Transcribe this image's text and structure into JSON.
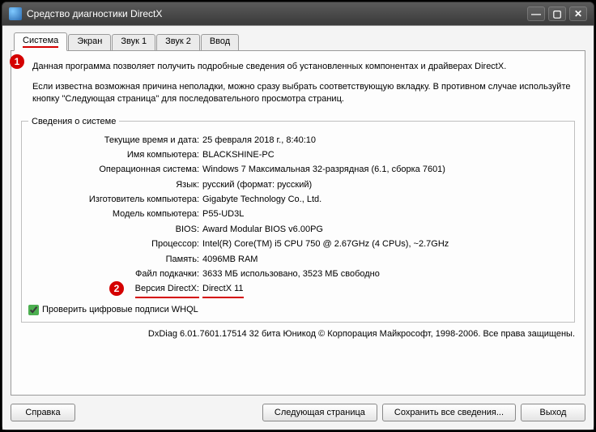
{
  "window": {
    "title": "Средство диагностики DirectX"
  },
  "tabs": [
    "Система",
    "Экран",
    "Звук 1",
    "Звук 2",
    "Ввод"
  ],
  "intro": {
    "p1": "Данная программа позволяет получить подробные сведения об установленных компонентах и драйверах DirectX.",
    "p2": "Если известна возможная причина неполадки, можно сразу выбрать соответствующую вкладку. В противном случае используйте кнопку \"Следующая страница\" для последовательного просмотра страниц."
  },
  "sysinfo": {
    "legend": "Сведения о системе",
    "rows": [
      {
        "label": "Текущие время и дата:",
        "value": "25 февраля 2018 г., 8:40:10"
      },
      {
        "label": "Имя компьютера:",
        "value": "BLACKSHINE-PC"
      },
      {
        "label": "Операционная система:",
        "value": "Windows 7 Максимальная 32-разрядная (6.1, сборка 7601)"
      },
      {
        "label": "Язык:",
        "value": "русский (формат: русский)"
      },
      {
        "label": "Изготовитель компьютера:",
        "value": "Gigabyte Technology Co., Ltd."
      },
      {
        "label": "Модель компьютера:",
        "value": "P55-UD3L"
      },
      {
        "label": "BIOS:",
        "value": "Award Modular BIOS v6.00PG"
      },
      {
        "label": "Процессор:",
        "value": "Intel(R) Core(TM) i5 CPU       750  @ 2.67GHz (4 CPUs), ~2.7GHz"
      },
      {
        "label": "Память:",
        "value": "4096MB RAM"
      },
      {
        "label": "Файл подкачки:",
        "value": "3633 МБ использовано, 3523 МБ свободно"
      },
      {
        "label": "Версия DirectX:",
        "value": "DirectX 11"
      }
    ]
  },
  "checkbox": {
    "label": "Проверить цифровые подписи WHQL",
    "checked": true
  },
  "footer": "DxDiag 6.01.7601.17514 32 бита Юникод  © Корпорация Майкрософт, 1998-2006.  Все права защищены.",
  "buttons": {
    "help": "Справка",
    "next": "Следующая страница",
    "save": "Сохранить все сведения...",
    "exit": "Выход"
  },
  "annotations": {
    "1": "1",
    "2": "2"
  }
}
